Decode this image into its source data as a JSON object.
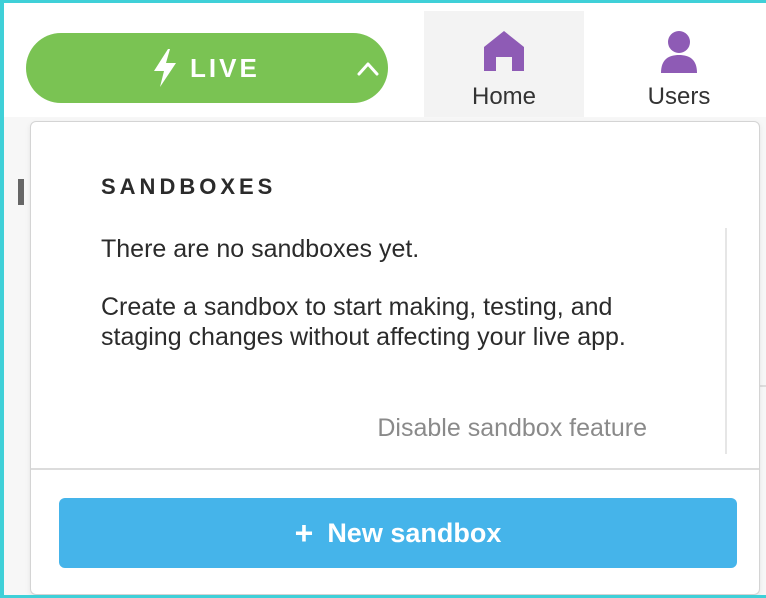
{
  "colors": {
    "live_green": "#7ac353",
    "nav_icon_purple": "#8e5bb5",
    "primary_blue": "#45b4ea",
    "frame_cyan": "#3fd0d8"
  },
  "topbar": {
    "live_button": {
      "icon": "lightning-bolt-icon",
      "label": "LIVE",
      "chevron": "chevron-up-icon"
    },
    "nav": [
      {
        "icon": "home-icon",
        "label": "Home"
      },
      {
        "icon": "user-icon",
        "label": "Users"
      }
    ]
  },
  "sandboxes_panel": {
    "heading": "SANDBOXES",
    "empty_message": "There are no sandboxes yet.",
    "help_text": "Create a sandbox to start making, testing, and staging changes without affecting your live app.",
    "disable_link": "Disable sandbox feature",
    "new_button": {
      "icon": "plus-icon",
      "icon_glyph": "+",
      "label": "New sandbox"
    }
  }
}
